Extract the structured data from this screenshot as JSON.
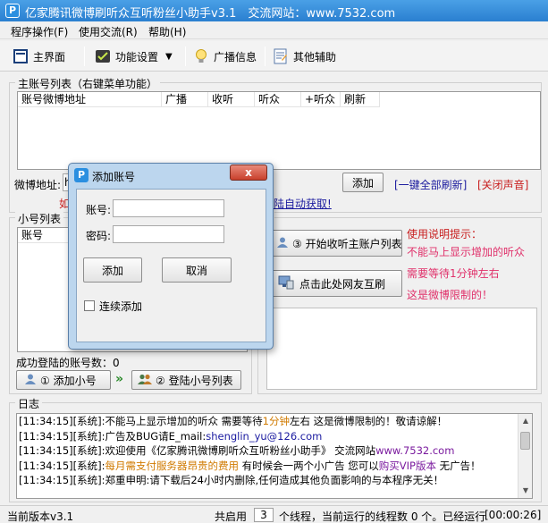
{
  "window": {
    "title": "亿家腾讯微博刷听众互听粉丝小助手v3.1　交流网站：www.7532.com",
    "app_icon_letter": "P"
  },
  "menu": [
    "程序操作(F)",
    "使用交流(R)",
    "帮助(H)"
  ],
  "toolbar": {
    "main_ui": "主界面",
    "settings": "功能设置",
    "broadcast": "广播信息",
    "other": "其他辅助"
  },
  "main_accounts": {
    "legend": "主账号列表（右键菜单功能）",
    "columns": [
      "账号微博地址",
      "广播",
      "收听",
      "听众",
      "+听众",
      "刷新"
    ]
  },
  "weibo_row": {
    "label": "微博地址:",
    "input_value": "h",
    "hidden_red": "如",
    "auto_link": "陆自动获取!",
    "add_button": "添加",
    "refresh_all": "[一键全部刷新]",
    "mute": "[关闭声音]"
  },
  "sub_accounts": {
    "legend": "小号列表",
    "columns": [
      "账号"
    ],
    "success_count_label": "成功登陆的账号数：0",
    "add_button": "① 添加小号",
    "arrow": "»",
    "login_button": "② 登陆小号列表"
  },
  "functions": {
    "legend_fragment": "能",
    "start_button": "③ 开始收听主账户列表",
    "mutual_button": "点击此处网友互刷",
    "tips_title": "使用说明提示：",
    "tips": [
      "不能马上显示增加的听众",
      "需要等待1分钟左右",
      "这是微博限制的！"
    ]
  },
  "log": {
    "legend": "日志",
    "lines": [
      {
        "parts": [
          {
            "t": "[11:34:15][系统]:不能马上显示增加的听众 需要等待",
            "c": ""
          },
          {
            "t": "1分钟",
            "c": "#d07a00"
          },
          {
            "t": "左右 这是微博限制的！敬请谅解！",
            "c": ""
          }
        ]
      },
      {
        "parts": [
          {
            "t": "[11:34:15][系统]:广告及BUG请E_mail:",
            "c": ""
          },
          {
            "t": "shenglin_yu@126.com",
            "c": "#1a1aa0"
          }
        ]
      },
      {
        "parts": [
          {
            "t": "[11:34:15][系统]:欢迎使用《亿家腾讯微博刷听众互听粉丝小助手》 交流网站",
            "c": ""
          },
          {
            "t": "www.7532.com",
            "c": "#7a1a9e"
          }
        ]
      },
      {
        "parts": [
          {
            "t": "[11:34:15][系统]:",
            "c": ""
          },
          {
            "t": "每月需支付服务器昂贵的费用",
            "c": "#d07a00"
          },
          {
            "t": " 有时候会一两个小广告 您可以",
            "c": ""
          },
          {
            "t": "购买VIP版本",
            "c": "#7a1a9e"
          },
          {
            "t": " 无广告！",
            "c": ""
          }
        ]
      },
      {
        "parts": [
          {
            "t": "[11:34:15][系统]:郑重申明:请下载后24小时内删除,任何造成其他负面影响的与本程序无关！",
            "c": ""
          }
        ]
      }
    ]
  },
  "status": {
    "version": "当前版本v3.1",
    "threads_prefix": "共启用",
    "threads_value": "3",
    "threads_suffix": "个线程，当前运行的线程数 0 个。已经运行",
    "elapsed": "[00:00:26]"
  },
  "dialog": {
    "title": "添加账号",
    "close": "x",
    "account_label": "账号:",
    "password_label": "密码:",
    "account_value": "",
    "password_value": "",
    "add_button": "添加",
    "cancel_button": "取消",
    "continuous_label": "连续添加"
  },
  "colors": {
    "titlebar": "#2a7fd0",
    "link_blue": "#1a1a9e",
    "link_red": "#c81e1e",
    "tips_pink": "#e0306a",
    "dialog_frame": "#bcd6ee"
  }
}
